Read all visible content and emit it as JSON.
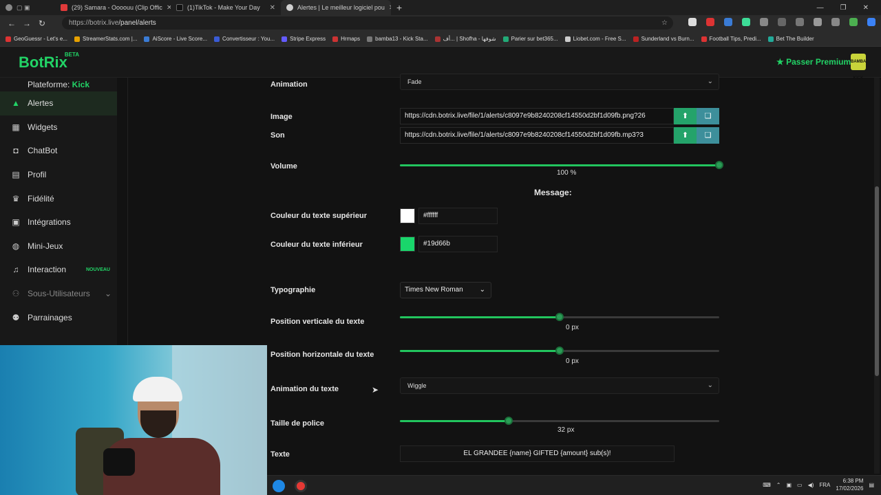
{
  "browser": {
    "tabs": [
      {
        "title": "(29) Samara - Oooouu (Clip Offic",
        "color": "#e03a3a"
      },
      {
        "title": "(1)TikTok - Make Your Day",
        "color": "#111111"
      },
      {
        "title": "Alertes | Le meilleur logiciel pou",
        "color": "#22d366"
      }
    ],
    "url_host": "https://botrix.live",
    "url_path": "/panel/alerts",
    "bookmarks": [
      "GeoGuessr - Let's e...",
      "StreamerStats.com |...",
      "AiScore - Live Score...",
      "Convertisseur : You...",
      "Stripe Express",
      "Hrmaps",
      "bamba13 - Kick Sta...",
      "أف... | Shofha - شوفها",
      "Parier sur bet365...",
      "Liobet.com - Free S...",
      "Sunderland vs Burn...",
      "Football Tips, Predi...",
      "Bet The Builder"
    ]
  },
  "app": {
    "logo": "BotRix",
    "logo_badge": "BETA",
    "premium_label": "Passer Premium",
    "avatar_text": "BAMBA KICK",
    "accent": "#22d366"
  },
  "sidebar": {
    "platform_label": "Plateforme:",
    "platform_value": "Kick",
    "items": [
      {
        "label": "Alertes",
        "icon": "warning-icon"
      },
      {
        "label": "Widgets",
        "icon": "grid-icon"
      },
      {
        "label": "ChatBot",
        "icon": "robot-icon"
      },
      {
        "label": "Profil",
        "icon": "id-card-icon"
      },
      {
        "label": "Fidélité",
        "icon": "trophy-icon"
      },
      {
        "label": "Intégrations",
        "icon": "window-icon"
      },
      {
        "label": "Mini-Jeux",
        "icon": "gamepad-icon"
      },
      {
        "label": "Interaction",
        "icon": "music-icon",
        "badge": "NOUVEAU"
      },
      {
        "label": "Sous-Utilisateurs",
        "icon": "users-icon"
      },
      {
        "label": "Parrainages",
        "icon": "user-group-icon"
      }
    ]
  },
  "form": {
    "animation_label": "Animation",
    "animation_value": "Fade",
    "image_label": "Image",
    "image_url": "https://cdn.botrix.live/file/1/alerts/c8097e9b8240208cf14550d2bf1d09fb.png?26",
    "sound_label": "Son",
    "sound_url": "https://cdn.botrix.live/file/1/alerts/c8097e9b8240208cf14550d2bf1d09fb.mp3?3",
    "volume_label": "Volume",
    "volume_value": "100",
    "volume_unit": "%",
    "volume_fraction": 1.0,
    "message_title": "Message:",
    "top_color_label": "Couleur du texte supérieur",
    "top_color": "#ffffff",
    "bottom_color_label": "Couleur du texte inférieur",
    "bottom_color": "#19d66b",
    "typography_label": "Typographie",
    "typography_value": "Times New Roman",
    "vpos_label": "Position verticale du texte",
    "vpos_value": "0",
    "vpos_fraction": 0.5,
    "hpos_label": "Position horizontale du texte",
    "hpos_value": "0",
    "hpos_fraction": 0.5,
    "unit_px": "px",
    "text_anim_label": "Animation du texte",
    "text_anim_value": "Wiggle",
    "font_size_label": "Taille de police",
    "font_size_value": "32",
    "font_size_fraction": 0.34,
    "text_label": "Texte",
    "text_value": "EL GRANDEE {name} GIFTED {amount} sub(s)!"
  },
  "taskbar": {
    "lang": "FRA",
    "time": "6:38 PM",
    "date": "17/02/2026"
  }
}
